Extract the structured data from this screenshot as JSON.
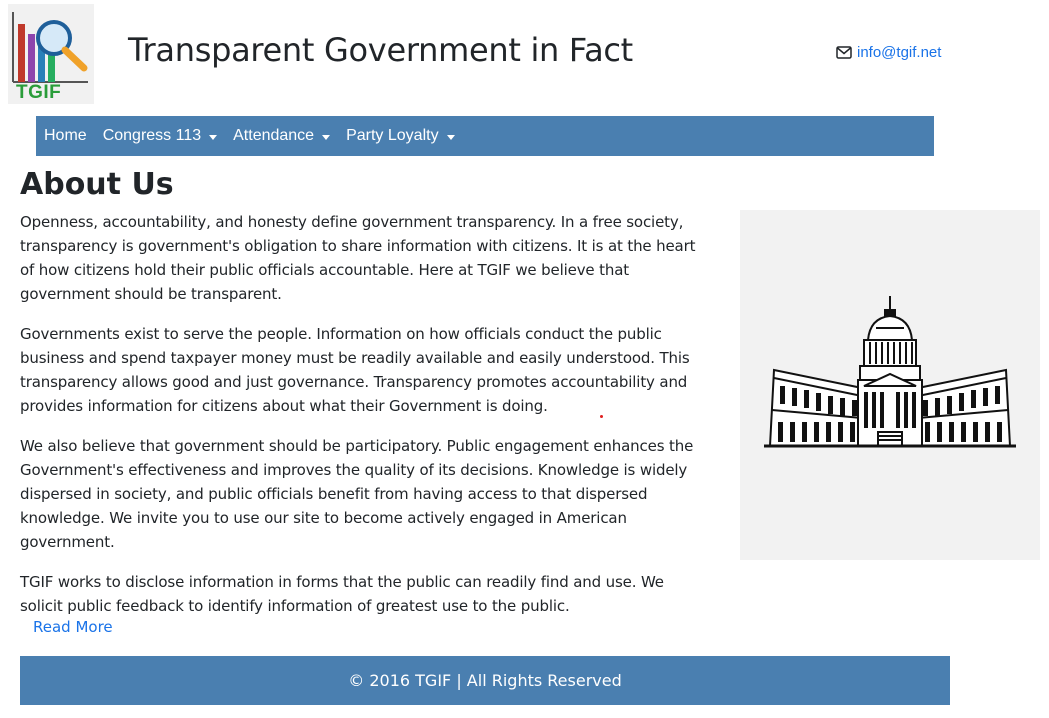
{
  "header": {
    "logo_text": "TGIF",
    "site_title": "Transparent Government in Fact",
    "contact_email": "info@tgif.net",
    "email_icon": "envelope-icon"
  },
  "nav": {
    "items": [
      {
        "label": "Home",
        "dropdown": false
      },
      {
        "label": "Congress 113",
        "dropdown": true
      },
      {
        "label": "Attendance",
        "dropdown": true
      },
      {
        "label": "Party Loyalty",
        "dropdown": true
      }
    ]
  },
  "main": {
    "heading": "About Us",
    "paragraphs": [
      "Openness, accountability, and honesty define government transparency. In a free society, transparency is government's obligation to share information with citizens. It is at the heart of how citizens hold their public officials accountable. Here at TGIF we believe that government should be transparent.",
      "Governments exist to serve the people. Information on how officials conduct the public business and spend taxpayer money must be readily available and easily understood. This transparency allows good and just governance. Transparency promotes accountability and provides information for citizens about what their Government is doing.",
      "We also believe that government should be participatory. Public engagement enhances the Government's effectiveness and improves the quality of its decisions. Knowledge is widely dispersed in society, and public officials benefit from having access to that dispersed knowledge. We invite you to use our site to become actively engaged in American government.",
      "TGIF works to disclose information in forms that the public can readily find and use. We solicit public feedback to identify information of greatest use to the public."
    ],
    "read_more": "Read More",
    "image_icon": "capitol-building-icon"
  },
  "footer": {
    "text": "© 2016 TGIF | All Rights Reserved"
  },
  "colors": {
    "nav_bg": "#4a7fb0",
    "link": "#1a73e8",
    "logo_green": "#2a9d3a"
  }
}
